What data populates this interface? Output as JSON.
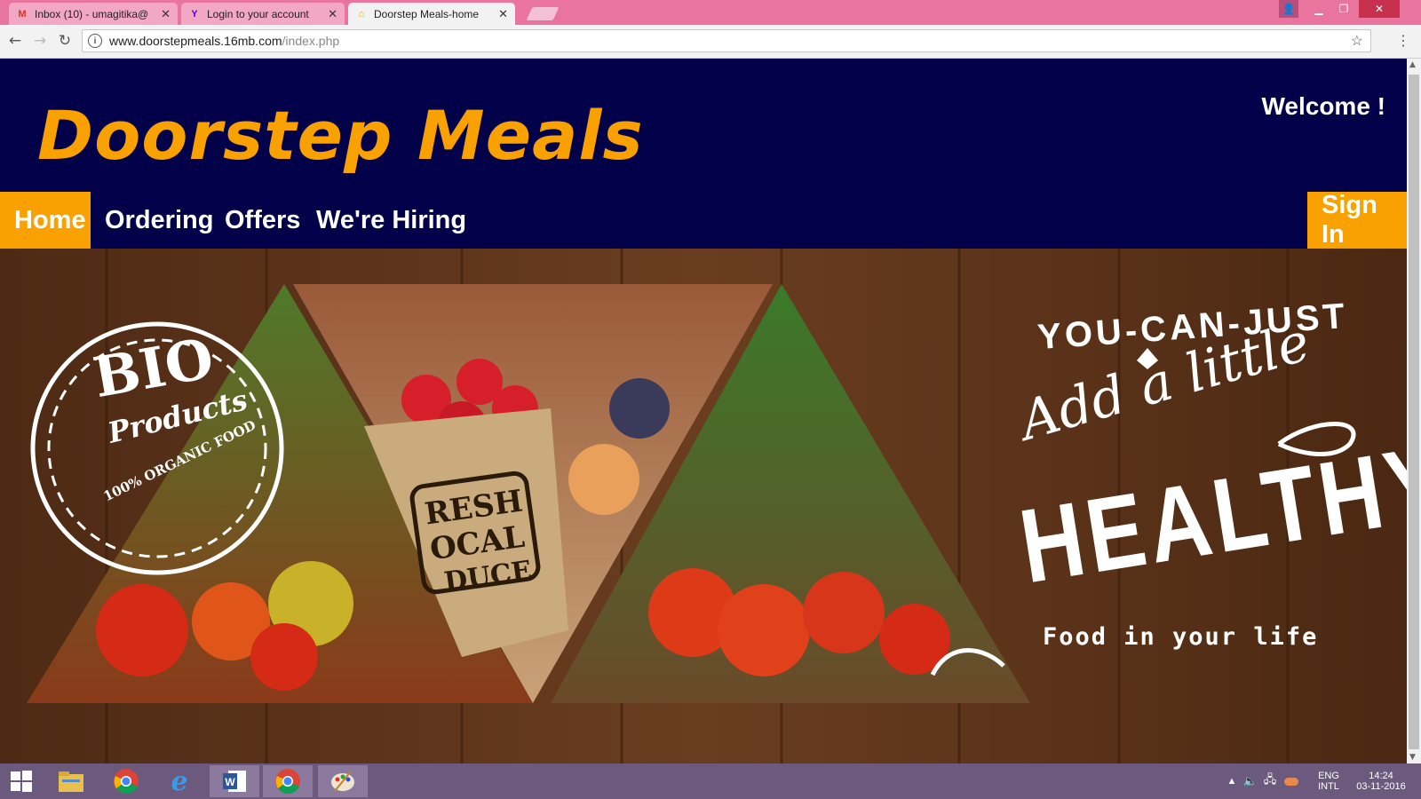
{
  "browser": {
    "tabs": [
      {
        "title": "Inbox (10) - umagitika@",
        "favicon": "gmail-icon"
      },
      {
        "title": "Login to your account",
        "favicon": "yahoo-icon"
      },
      {
        "title": "Doorstep Meals-home",
        "favicon": "site-icon"
      }
    ],
    "url_host": "www.doorstepmeals.16mb.com",
    "url_path": "/index.php"
  },
  "site": {
    "logo": "Doorstep Meals",
    "welcome": "Welcome !",
    "nav": [
      "Home",
      "Ordering",
      "Offers",
      "We're Hiring"
    ],
    "signin": "Sign In",
    "active_nav": "Home",
    "colors": {
      "header_bg": "#03004a",
      "accent": "#f9a100",
      "banner_wood": "#5a331c"
    }
  },
  "banner": {
    "badge_title": "BIO",
    "badge_sub": "Products",
    "badge_ring": "100% ORGANIC FOOD",
    "bag_text_1": "RESH",
    "bag_text_2": "OCAL",
    "bag_text_3": "DUCE",
    "line1": "YOU-CAN-JUST",
    "line2": "Add a little",
    "line3": "HEALTHY",
    "line4": "Food in your life"
  },
  "taskbar": {
    "lang_1": "ENG",
    "lang_2": "INTL",
    "time": "14:24",
    "date": "03-11-2016"
  }
}
